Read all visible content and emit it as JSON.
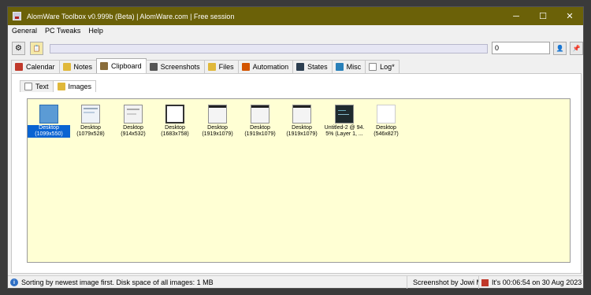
{
  "window": {
    "title": "AlomWare Toolbox v0.999b (Beta)  |  AlomWare.com  |  Free session",
    "minimize": "─",
    "maximize": "☐",
    "close": "✕"
  },
  "menu": [
    "General",
    "PC Tweaks",
    "Help"
  ],
  "toolbar": {
    "settings_glyph": "⚙",
    "clipboard_glyph": "📋",
    "count_value": "0",
    "user_glyph": "👤",
    "pin_glyph": "📌"
  },
  "tabs": [
    {
      "label": "Calendar",
      "color": "#c0392b"
    },
    {
      "label": "Notes",
      "color": "#e0b83a"
    },
    {
      "label": "Clipboard",
      "color": "#8a6d3b"
    },
    {
      "label": "Screenshots",
      "color": "#555555"
    },
    {
      "label": "Files",
      "color": "#e0b83a"
    },
    {
      "label": "Automation",
      "color": "#d35400"
    },
    {
      "label": "States",
      "color": "#2c3e50"
    },
    {
      "label": "Misc",
      "color": "#2980b9"
    },
    {
      "label": "Log*",
      "color": "#aaaaaa"
    }
  ],
  "subtabs": [
    {
      "label": "Text"
    },
    {
      "label": "Images"
    }
  ],
  "images": [
    {
      "line1": "Desktop",
      "line2": "(1099x550)",
      "style": "blue"
    },
    {
      "line1": "Desktop",
      "line2": "(1079x528)",
      "style": "light"
    },
    {
      "line1": "Desktop",
      "line2": "(914x532)",
      "style": "light"
    },
    {
      "line1": "Desktop",
      "line2": "(1683x758)",
      "style": "window"
    },
    {
      "line1": "Desktop",
      "line2": "(1919x1079)",
      "style": "dark-top"
    },
    {
      "line1": "Desktop",
      "line2": "(1919x1079)",
      "style": "dark-top"
    },
    {
      "line1": "Desktop",
      "line2": "(1919x1079)",
      "style": "dark-top"
    },
    {
      "line1": "Untitled-2 @ 94.",
      "line2": "5% (Layer 1, ...",
      "style": "dark"
    },
    {
      "line1": "Desktop",
      "line2": "(546x827)",
      "style": "white"
    }
  ],
  "status": {
    "info": "Sorting by newest image first. Disk space of all images: 1 MB",
    "screenshot": "Screenshot by Jowi M",
    "time": "It's 00:06:54 on 30 Aug 2023"
  }
}
